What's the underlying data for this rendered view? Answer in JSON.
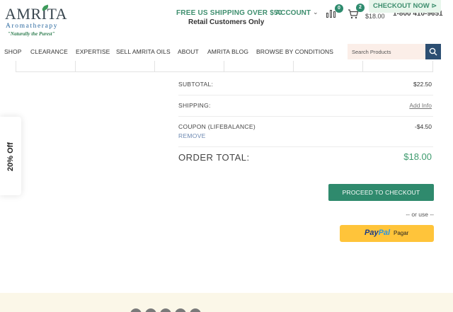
{
  "header": {
    "logo": {
      "word": "AMRITA",
      "sub": "Aromatherapy",
      "tagline": "\"Naturally the Purest\""
    },
    "shipping_promo": "FREE US SHIPPING OVER $50",
    "retail_note": "Retail Customers Only",
    "account_label": "ACCOUNT",
    "compare_count": "0",
    "cart_count": "2",
    "cart_total": "$18.00",
    "phone": "1-800 410-9651",
    "checkout_now": "CHECKOUT NOW ⊳"
  },
  "nav": {
    "items": [
      "SHOP",
      "CLEARANCE",
      "EXPERTISE",
      "SELL AMRITA OILS",
      "ABOUT",
      "AMRITA BLOG",
      "BROWSE BY CONDITIONS"
    ],
    "search_placeholder": "Search Products"
  },
  "totals": {
    "subtotal_label": "SUBTOTAL:",
    "subtotal_value": "$22.50",
    "shipping_label": "SHIPPING:",
    "shipping_value": "Add Info",
    "coupon_label": "COUPON (LIFEBALANCE)",
    "coupon_value": "-$4.50",
    "remove_label": "REMOVE",
    "order_total_label": "ORDER TOTAL:",
    "order_total_value": "$18.00"
  },
  "actions": {
    "proceed_label": "PROCEED TO CHECKOUT",
    "or_use": "-- or use --",
    "paypal_pay": "Pay",
    "paypal_pal": "Pal",
    "paypal_text": "Pagar"
  },
  "side_tab": {
    "label": "20% Off"
  },
  "colors": {
    "brand_green": "#2f8a6d",
    "navy": "#2c4e72",
    "paypal_yellow": "#ffc43a"
  }
}
